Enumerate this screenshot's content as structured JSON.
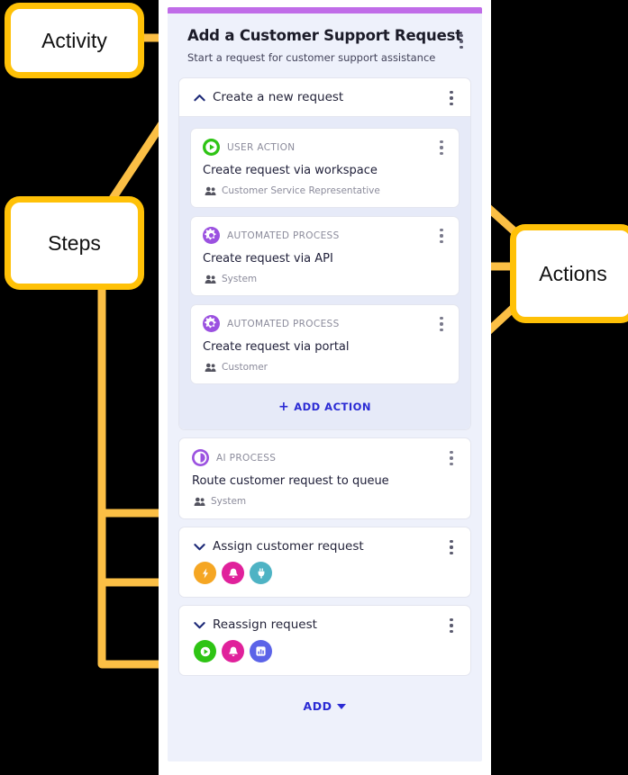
{
  "annotations": {
    "activity": "Activity",
    "steps": "Steps",
    "actions": "Actions",
    "accent_color": "#ffc107",
    "connector_color": "#fbbf45"
  },
  "panel": {
    "accent_color": "#c06ce8",
    "title": "Add a Customer Support Request",
    "subtitle": "Start a request for customer support assistance",
    "menu_icon": "kebab-menu-icon"
  },
  "steps": [
    {
      "id": "create-a-new-request",
      "title": "Create a new request",
      "expanded": true,
      "chevron": "chevron-up-icon",
      "menu_icon": "kebab-menu-icon",
      "actions": [
        {
          "type": "USER ACTION",
          "type_icon": "play-circle-icon",
          "type_color": "#2ec414",
          "name": "Create request via workspace",
          "role_icon": "people-icon",
          "role": "Customer Service Representative",
          "menu_icon": "kebab-menu-icon"
        },
        {
          "type": "AUTOMATED PROCESS",
          "type_icon": "gear-circle-icon",
          "type_color": "#9b51e0",
          "name": "Create request via API",
          "role_icon": "people-icon",
          "role": "System",
          "menu_icon": "kebab-menu-icon"
        },
        {
          "type": "AUTOMATED PROCESS",
          "type_icon": "gear-circle-icon",
          "type_color": "#9b51e0",
          "name": "Create request via portal",
          "role_icon": "people-icon",
          "role": "Customer",
          "menu_icon": "kebab-menu-icon"
        }
      ],
      "add_action_label": "ADD ACTION",
      "add_action_icon": "plus-icon"
    },
    {
      "id": "route-customer-request-to-queue",
      "kind": "flat",
      "type": "AI PROCESS",
      "type_icon": "ai-half-circle-icon",
      "type_color": "#9b51e0",
      "name": "Route customer request to queue",
      "role_icon": "people-icon",
      "role": "System",
      "menu_icon": "kebab-menu-icon"
    },
    {
      "id": "assign-customer-request",
      "title": "Assign customer request",
      "expanded": false,
      "chevron": "chevron-down-icon",
      "menu_icon": "kebab-menu-icon",
      "chips": [
        {
          "icon": "lightning-bolt-icon",
          "color": "#f5a623"
        },
        {
          "icon": "bell-icon",
          "color": "#e0219b"
        },
        {
          "icon": "plug-icon",
          "color": "#4eb3c4"
        }
      ]
    },
    {
      "id": "reassign-request",
      "title": "Reassign request",
      "expanded": false,
      "chevron": "chevron-down-icon",
      "menu_icon": "kebab-menu-icon",
      "chips": [
        {
          "icon": "play-circle-icon",
          "color": "#2ec414"
        },
        {
          "icon": "bell-icon",
          "color": "#e0219b"
        },
        {
          "icon": "bar-chart-icon",
          "color": "#5b63e8"
        }
      ]
    }
  ],
  "footer": {
    "add_label": "ADD",
    "caret_icon": "caret-down-icon"
  }
}
